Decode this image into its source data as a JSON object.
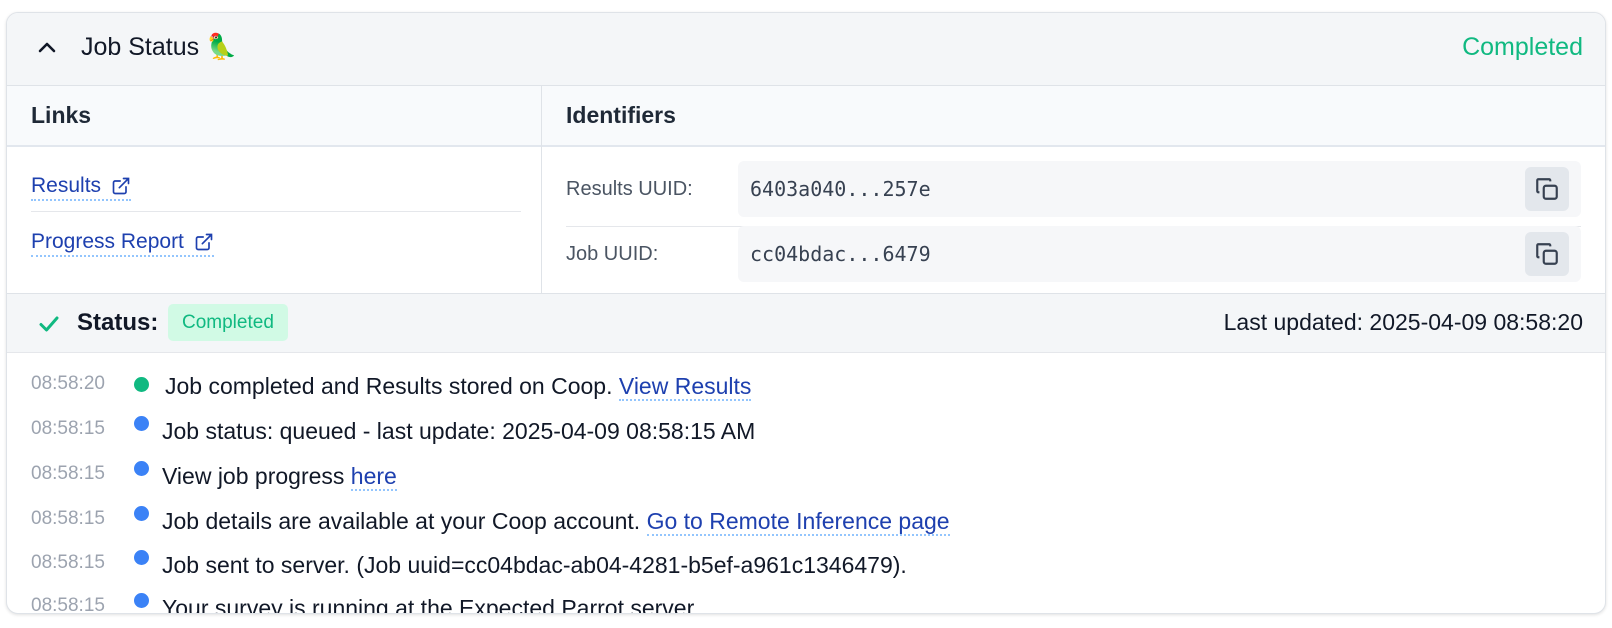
{
  "header": {
    "title": "Job Status 🦜",
    "status": "Completed"
  },
  "links": {
    "heading": "Links",
    "items": [
      {
        "label": "Results"
      },
      {
        "label": "Progress Report"
      }
    ]
  },
  "identifiers": {
    "heading": "Identifiers",
    "items": [
      {
        "label": "Results UUID:",
        "value": "6403a040...257e"
      },
      {
        "label": "Job UUID:",
        "value": "cc04bdac...6479"
      }
    ]
  },
  "status": {
    "label": "Status:",
    "badge": "Completed",
    "last_updated": "Last updated: 2025-04-09 08:58:20"
  },
  "colors": {
    "success": "#10b981",
    "info_dot": "#3b82f6",
    "link": "#1e40af"
  },
  "log": [
    {
      "time": "08:58:20",
      "dot": "success",
      "text": "Job completed and Results stored on Coop. ",
      "link": "View Results"
    },
    {
      "time": "08:58:15",
      "dot": "info",
      "text": "Job status: queued - last update: 2025-04-09 08:58:15 AM",
      "link": ""
    },
    {
      "time": "08:58:15",
      "dot": "info",
      "text": "View job progress ",
      "link": "here"
    },
    {
      "time": "08:58:15",
      "dot": "info",
      "text": "Job details are available at your Coop account. ",
      "link": "Go to Remote Inference page"
    },
    {
      "time": "08:58:15",
      "dot": "info",
      "text": "Job sent to server. (Job uuid=cc04bdac-ab04-4281-b5ef-a961c1346479).",
      "link": ""
    },
    {
      "time": "08:58:15",
      "dot": "info",
      "text": "Your survey is running at the Expected Parrot server...",
      "link": ""
    }
  ]
}
